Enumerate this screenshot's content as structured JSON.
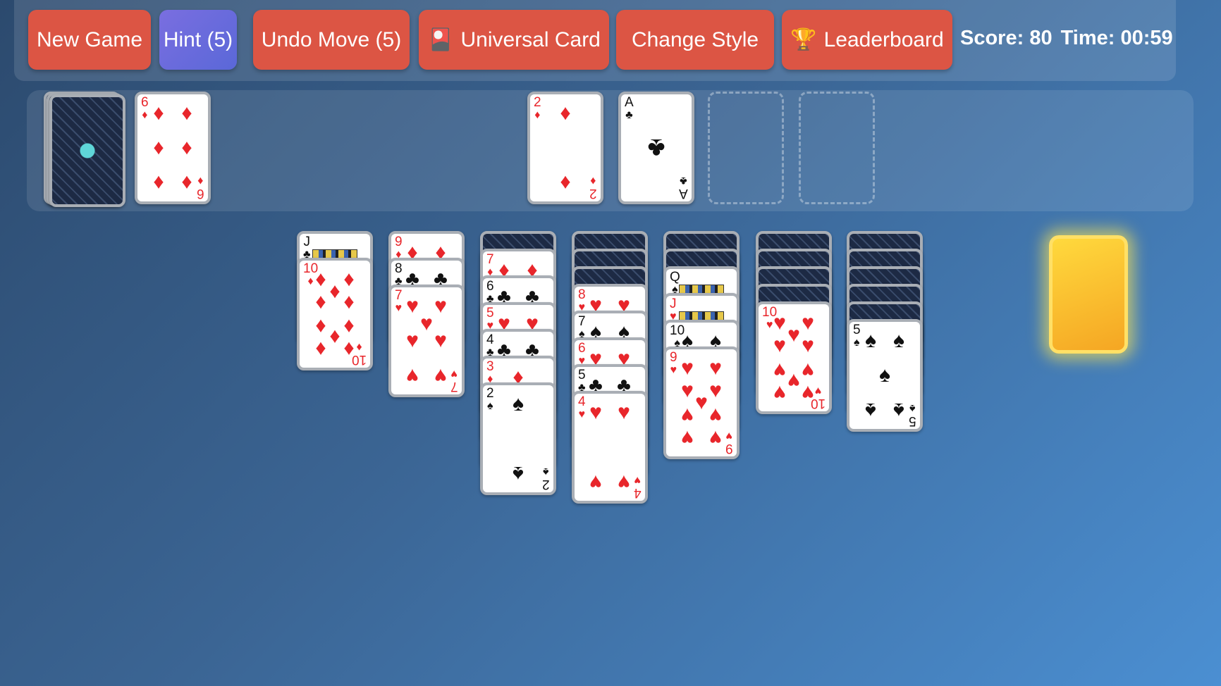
{
  "toolbar": {
    "new_game": "New Game",
    "hint": "Hint (5)",
    "undo": "Undo Move (5)",
    "universal": "Universal Card",
    "universal_icon": "🎴",
    "change_style": "Change Style",
    "leaderboard": "Leaderboard",
    "leaderboard_icon": "🏆"
  },
  "status": {
    "score": "Score: 80",
    "time": "Time: 00:59"
  },
  "colors": {
    "button": "#dc5544",
    "hint_button": "#6b6be0",
    "glow_card": "#f8c12f"
  },
  "waste_card": {
    "rank": "6",
    "suit": "♦"
  },
  "foundations": [
    {
      "rank": "2",
      "suit": "♦"
    },
    {
      "rank": "A",
      "suit": "♣"
    },
    null,
    null
  ],
  "tableau": [
    {
      "down": 0,
      "up": [
        {
          "rank": "J",
          "suit": "♣"
        },
        {
          "rank": "10",
          "suit": "♦"
        }
      ]
    },
    {
      "down": 0,
      "up": [
        {
          "rank": "9",
          "suit": "♦"
        },
        {
          "rank": "8",
          "suit": "♣"
        },
        {
          "rank": "7",
          "suit": "♥"
        }
      ]
    },
    {
      "down": 1,
      "up": [
        {
          "rank": "7",
          "suit": "♦"
        },
        {
          "rank": "6",
          "suit": "♣"
        },
        {
          "rank": "5",
          "suit": "♥"
        },
        {
          "rank": "4",
          "suit": "♣"
        },
        {
          "rank": "3",
          "suit": "♦"
        },
        {
          "rank": "2",
          "suit": "♠"
        }
      ]
    },
    {
      "down": 3,
      "up": [
        {
          "rank": "8",
          "suit": "♥"
        },
        {
          "rank": "7",
          "suit": "♠"
        },
        {
          "rank": "6",
          "suit": "♥"
        },
        {
          "rank": "5",
          "suit": "♣"
        },
        {
          "rank": "4",
          "suit": "♥"
        }
      ]
    },
    {
      "down": 2,
      "up": [
        {
          "rank": "Q",
          "suit": "♠"
        },
        {
          "rank": "J",
          "suit": "♥"
        },
        {
          "rank": "10",
          "suit": "♠"
        },
        {
          "rank": "9",
          "suit": "♥"
        }
      ]
    },
    {
      "down": 4,
      "up": [
        {
          "rank": "10",
          "suit": "♥"
        }
      ]
    },
    {
      "down": 5,
      "up": [
        {
          "rank": "5",
          "suit": "♠"
        }
      ]
    }
  ]
}
